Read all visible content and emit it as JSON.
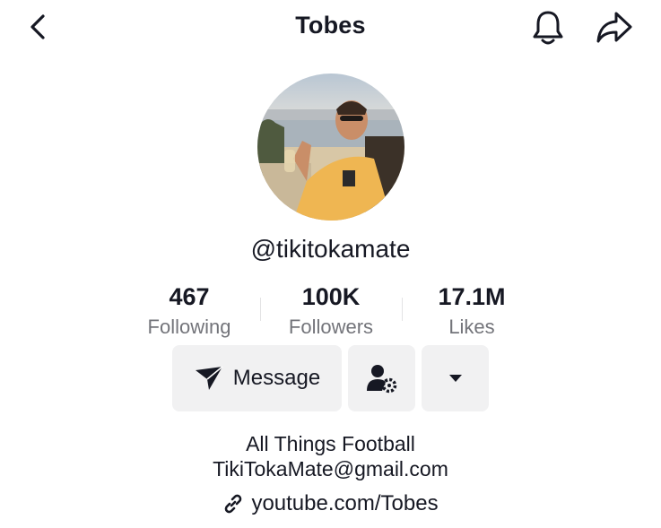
{
  "header": {
    "title": "Tobes",
    "back_icon": "chevron-left-icon",
    "bell_icon": "bell-icon",
    "share_icon": "share-arrow-icon"
  },
  "profile": {
    "username": "@tikitokamate",
    "avatar_icon": "profile-photo"
  },
  "stats": [
    {
      "value": "467",
      "label": "Following"
    },
    {
      "value": "100K",
      "label": "Followers"
    },
    {
      "value": "17.1M",
      "label": "Likes"
    }
  ],
  "actions": {
    "message_label": "Message",
    "message_icon": "send-icon",
    "friends_icon": "user-settings-icon",
    "more_icon": "caret-down-icon"
  },
  "bio": {
    "line1": "All Things Football",
    "line2": "TikiTokaMate@gmail.com",
    "link": "youtube.com/Tobes",
    "link_icon": "link-icon"
  },
  "colors": {
    "text": "#161823",
    "muted": "#73747a",
    "button_bg": "#f1f1f2"
  }
}
